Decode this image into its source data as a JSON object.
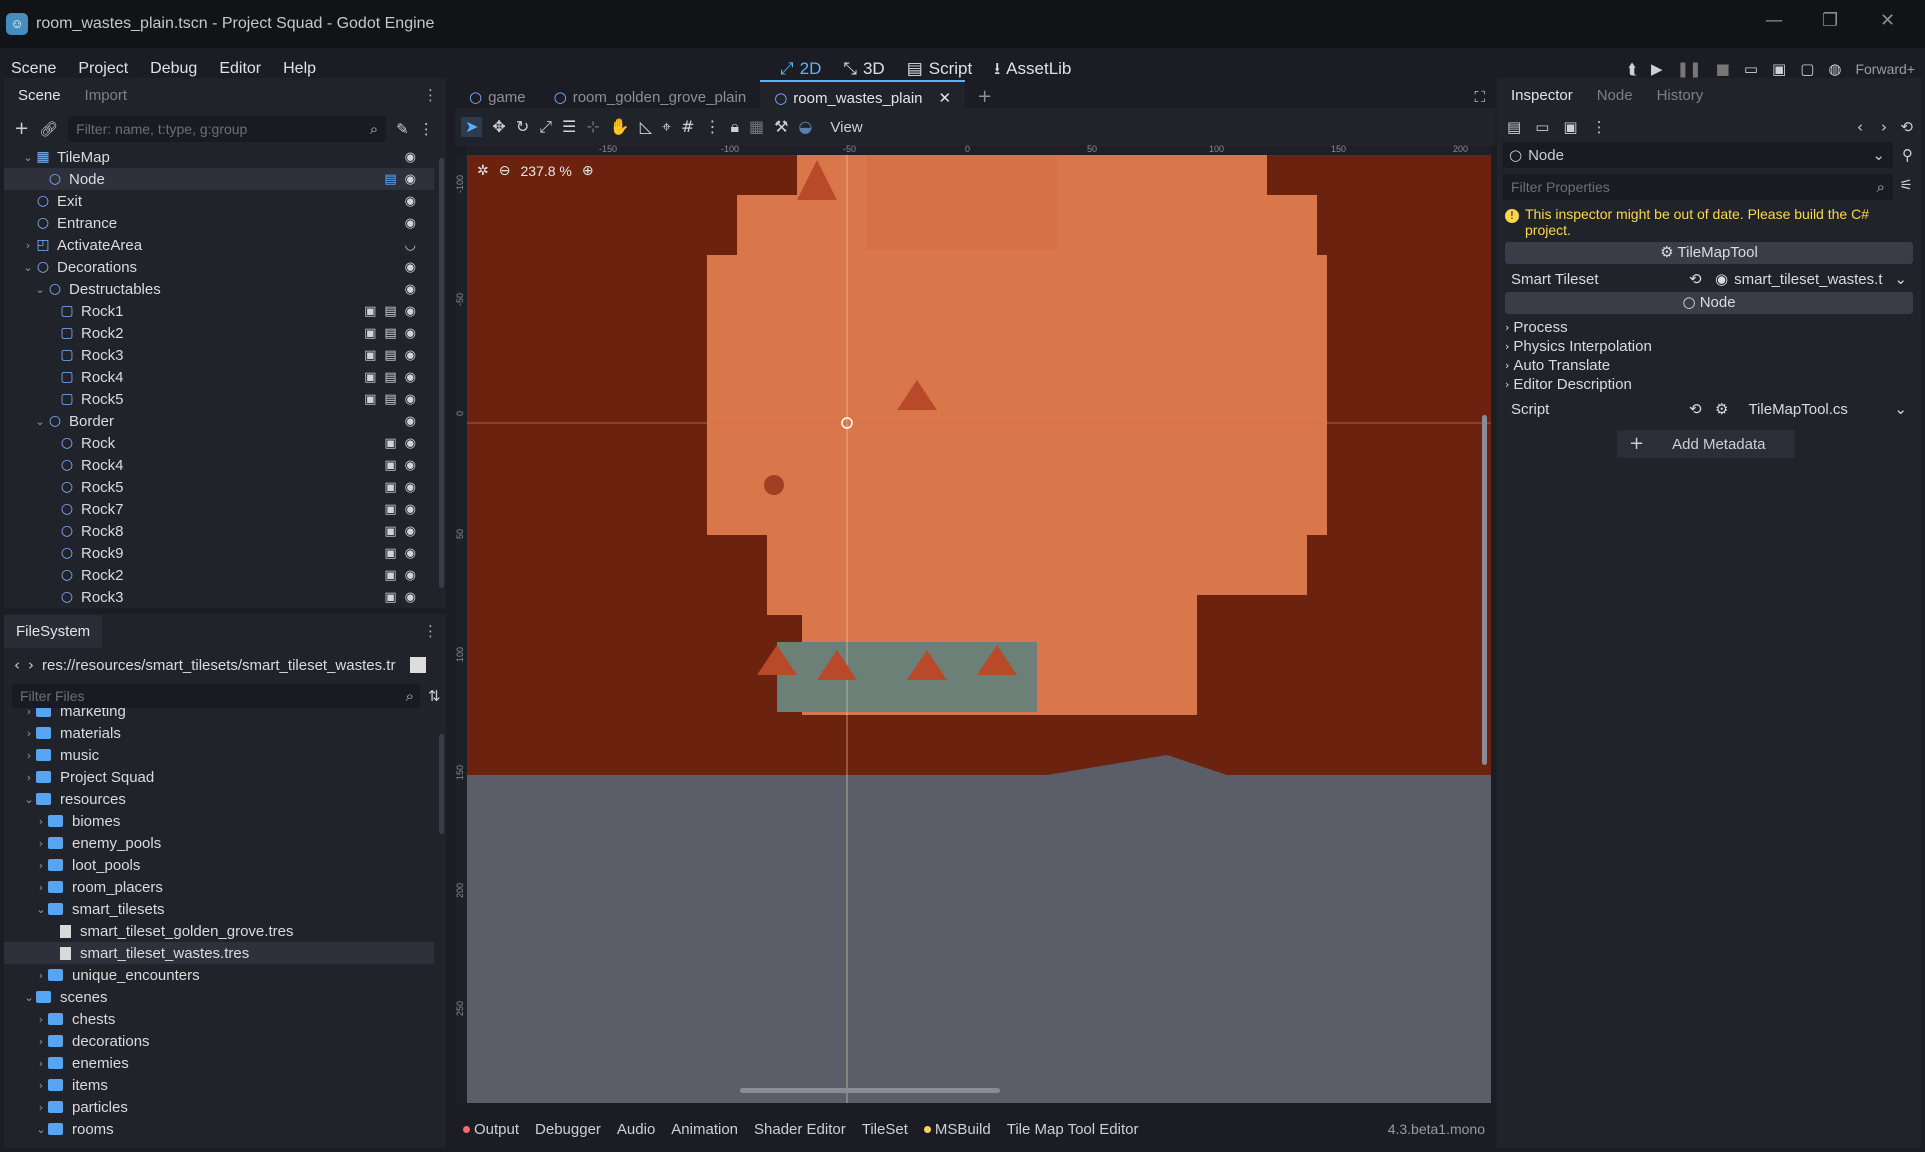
{
  "window": {
    "title": "room_wastes_plain.tscn - Project Squad - Godot Engine"
  },
  "menu": [
    "Scene",
    "Project",
    "Debug",
    "Editor",
    "Help"
  ],
  "main_modes": [
    {
      "label": "2D",
      "icon": "2d-icon",
      "active": true
    },
    {
      "label": "3D",
      "icon": "3d-icon",
      "active": false
    },
    {
      "label": "Script",
      "icon": "script-icon",
      "active": false
    },
    {
      "label": "AssetLib",
      "icon": "download-icon",
      "active": false
    }
  ],
  "renderer": "Forward+",
  "scene_dock": {
    "tabs": [
      "Scene",
      "Import"
    ],
    "filter_placeholder": "Filter: name, t:type, g:group",
    "tree": [
      {
        "label": "TileMap",
        "depth": 0,
        "expanded": true,
        "icon": "tilemap-icon"
      },
      {
        "label": "Node",
        "depth": 1,
        "selected": true,
        "icon": "node-icon"
      },
      {
        "label": "Exit",
        "depth": 0,
        "icon": "node-icon"
      },
      {
        "label": "Entrance",
        "depth": 0,
        "icon": "node-icon"
      },
      {
        "label": "ActivateArea",
        "depth": 0,
        "collapsed": true,
        "icon": "area-icon"
      },
      {
        "label": "Decorations",
        "depth": 0,
        "expanded": true,
        "icon": "node-icon"
      },
      {
        "label": "Destructables",
        "depth": 1,
        "expanded": true,
        "icon": "node-icon"
      },
      {
        "label": "Rock1",
        "depth": 2,
        "icon": "rock-icon"
      },
      {
        "label": "Rock2",
        "depth": 2,
        "icon": "rock-icon"
      },
      {
        "label": "Rock3",
        "depth": 2,
        "icon": "rock-icon"
      },
      {
        "label": "Rock4",
        "depth": 2,
        "icon": "rock-icon"
      },
      {
        "label": "Rock5",
        "depth": 2,
        "icon": "rock-icon"
      },
      {
        "label": "Border",
        "depth": 1,
        "expanded": true,
        "icon": "node-icon"
      },
      {
        "label": "Rock",
        "depth": 2,
        "icon": "node-icon"
      },
      {
        "label": "Rock4",
        "depth": 2,
        "icon": "node-icon"
      },
      {
        "label": "Rock5",
        "depth": 2,
        "icon": "node-icon"
      },
      {
        "label": "Rock7",
        "depth": 2,
        "icon": "node-icon"
      },
      {
        "label": "Rock8",
        "depth": 2,
        "icon": "node-icon"
      },
      {
        "label": "Rock9",
        "depth": 2,
        "icon": "node-icon"
      },
      {
        "label": "Rock2",
        "depth": 2,
        "icon": "node-icon"
      },
      {
        "label": "Rock3",
        "depth": 2,
        "icon": "node-icon"
      }
    ]
  },
  "filesystem_dock": {
    "tab": "FileSystem",
    "path": "res://resources/smart_tilesets/smart_tileset_wastes.tr",
    "filter_placeholder": "Filter Files",
    "items": [
      {
        "label": "marketing",
        "depth": 1,
        "type": "folder"
      },
      {
        "label": "materials",
        "depth": 1,
        "type": "folder"
      },
      {
        "label": "music",
        "depth": 1,
        "type": "folder"
      },
      {
        "label": "Project Squad",
        "depth": 1,
        "type": "folder"
      },
      {
        "label": "resources",
        "depth": 1,
        "type": "folder",
        "expanded": true
      },
      {
        "label": "biomes",
        "depth": 2,
        "type": "folder"
      },
      {
        "label": "enemy_pools",
        "depth": 2,
        "type": "folder"
      },
      {
        "label": "loot_pools",
        "depth": 2,
        "type": "folder"
      },
      {
        "label": "room_placers",
        "depth": 2,
        "type": "folder"
      },
      {
        "label": "smart_tilesets",
        "depth": 2,
        "type": "folder",
        "expanded": true
      },
      {
        "label": "smart_tileset_golden_grove.tres",
        "depth": 3,
        "type": "file"
      },
      {
        "label": "smart_tileset_wastes.tres",
        "depth": 3,
        "type": "file",
        "selected": true
      },
      {
        "label": "unique_encounters",
        "depth": 2,
        "type": "folder"
      },
      {
        "label": "scenes",
        "depth": 1,
        "type": "folder",
        "expanded": true
      },
      {
        "label": "chests",
        "depth": 2,
        "type": "folder"
      },
      {
        "label": "decorations",
        "depth": 2,
        "type": "folder"
      },
      {
        "label": "enemies",
        "depth": 2,
        "type": "folder"
      },
      {
        "label": "items",
        "depth": 2,
        "type": "folder"
      },
      {
        "label": "particles",
        "depth": 2,
        "type": "folder"
      },
      {
        "label": "rooms",
        "depth": 2,
        "type": "folder",
        "expanded": true
      }
    ]
  },
  "editor_tabs": [
    {
      "label": "game",
      "active": false
    },
    {
      "label": "room_golden_grove_plain",
      "active": false
    },
    {
      "label": "room_wastes_plain",
      "active": true
    }
  ],
  "viewport": {
    "zoom": "237.8 %",
    "view_menu": "View",
    "ruler_top": [
      "-150",
      "-100",
      "-50",
      "0",
      "50",
      "100",
      "150",
      "200"
    ],
    "ruler_left": [
      "-100",
      "-50",
      "0",
      "50",
      "100",
      "150",
      "200",
      "250"
    ]
  },
  "bottom_panel": {
    "tabs": [
      "Output",
      "Debugger",
      "Audio",
      "Animation",
      "Shader Editor",
      "TileSet",
      "MSBuild",
      "Tile Map Tool Editor"
    ],
    "version": "4.3.beta1.mono"
  },
  "inspector": {
    "tabs": [
      "Inspector",
      "Node",
      "History"
    ],
    "object": "Node",
    "filter_placeholder": "Filter Properties",
    "warning": "This inspector might be out of date. Please build the C# project.",
    "section_tool": "TileMapTool",
    "smart_tileset_label": "Smart Tileset",
    "smart_tileset_value": "smart_tileset_wastes.t",
    "section_node": "Node",
    "groups": [
      "Process",
      "Physics Interpolation",
      "Auto Translate",
      "Editor Description"
    ],
    "script_label": "Script",
    "script_value": "TileMapTool.cs",
    "add_metadata": "Add Metadata"
  },
  "colors": {
    "accent": "#57b3ff",
    "warning": "#ffd54f",
    "rock_dark": "#6b2310",
    "sand": "#d9774a",
    "void": "#5b5d69"
  }
}
